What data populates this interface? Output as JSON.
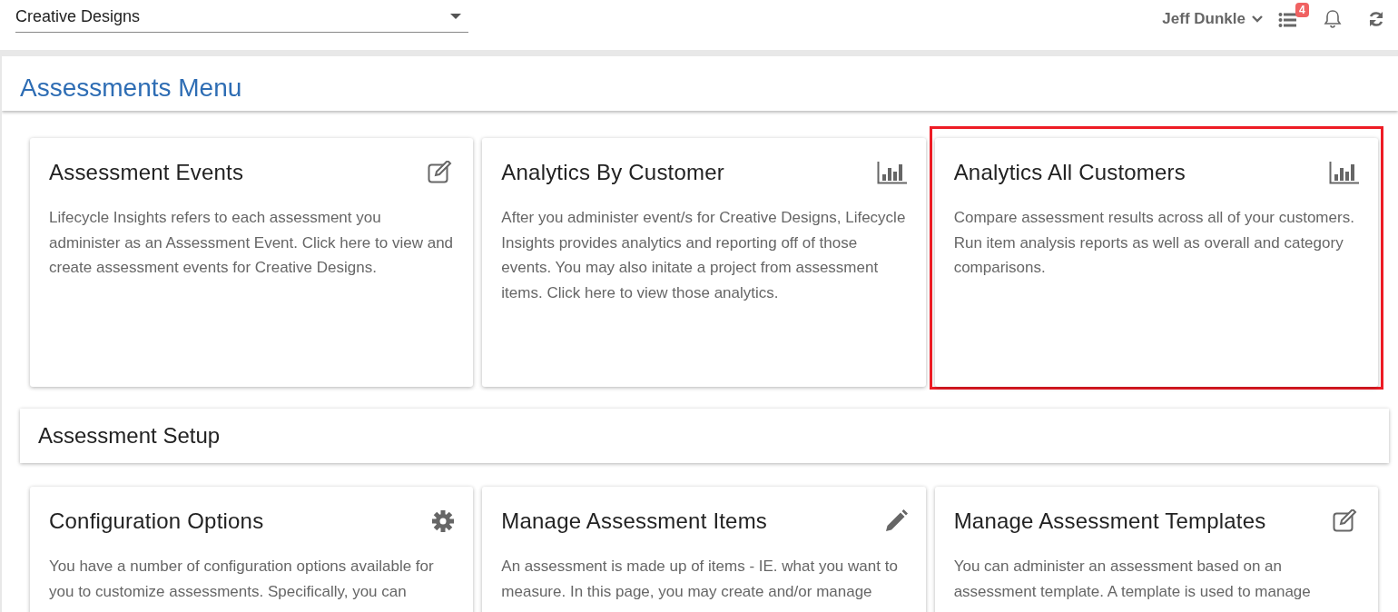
{
  "header": {
    "company_select": {
      "value": "Creative Designs"
    },
    "user": {
      "name": "Jeff Dunkle"
    },
    "task_count": "4"
  },
  "page": {
    "title": "Assessments Menu"
  },
  "sections": [
    {
      "cards": [
        {
          "title": "Assessment Events",
          "kind": "edit",
          "highlighted": false,
          "text": "Lifecycle Insights refers to each assessment you administer as an Assessment Event. Click here to view and create assessment events for Creative Designs."
        },
        {
          "title": "Analytics By Customer",
          "kind": "chart",
          "highlighted": false,
          "text": "After you administer event/s for Creative Designs, Lifecycle Insights provides analytics and reporting off of those events. You may also initate a project from assessment items. Click here to view those analytics."
        },
        {
          "title": "Analytics All Customers",
          "kind": "chart",
          "highlighted": true,
          "text": "Compare assessment results across all of your customers. Run item analysis reports as well as overall and category comparisons."
        }
      ]
    },
    {
      "title": "Assessment Setup",
      "cards": [
        {
          "title": "Configuration Options",
          "kind": "gear",
          "highlighted": false,
          "text": "You have a number of configuration options available for you to customize assessments. Specifically, you can"
        },
        {
          "title": "Manage Assessment Items",
          "kind": "pencil",
          "highlighted": false,
          "text": "An assessment is made up of items - IE. what you want to measure. In this page, you may create and/or manage"
        },
        {
          "title": "Manage Assessment Templates",
          "kind": "edit",
          "highlighted": false,
          "text": "You can administer an assessment based on an assessment template. A template is used to manage"
        }
      ]
    }
  ]
}
